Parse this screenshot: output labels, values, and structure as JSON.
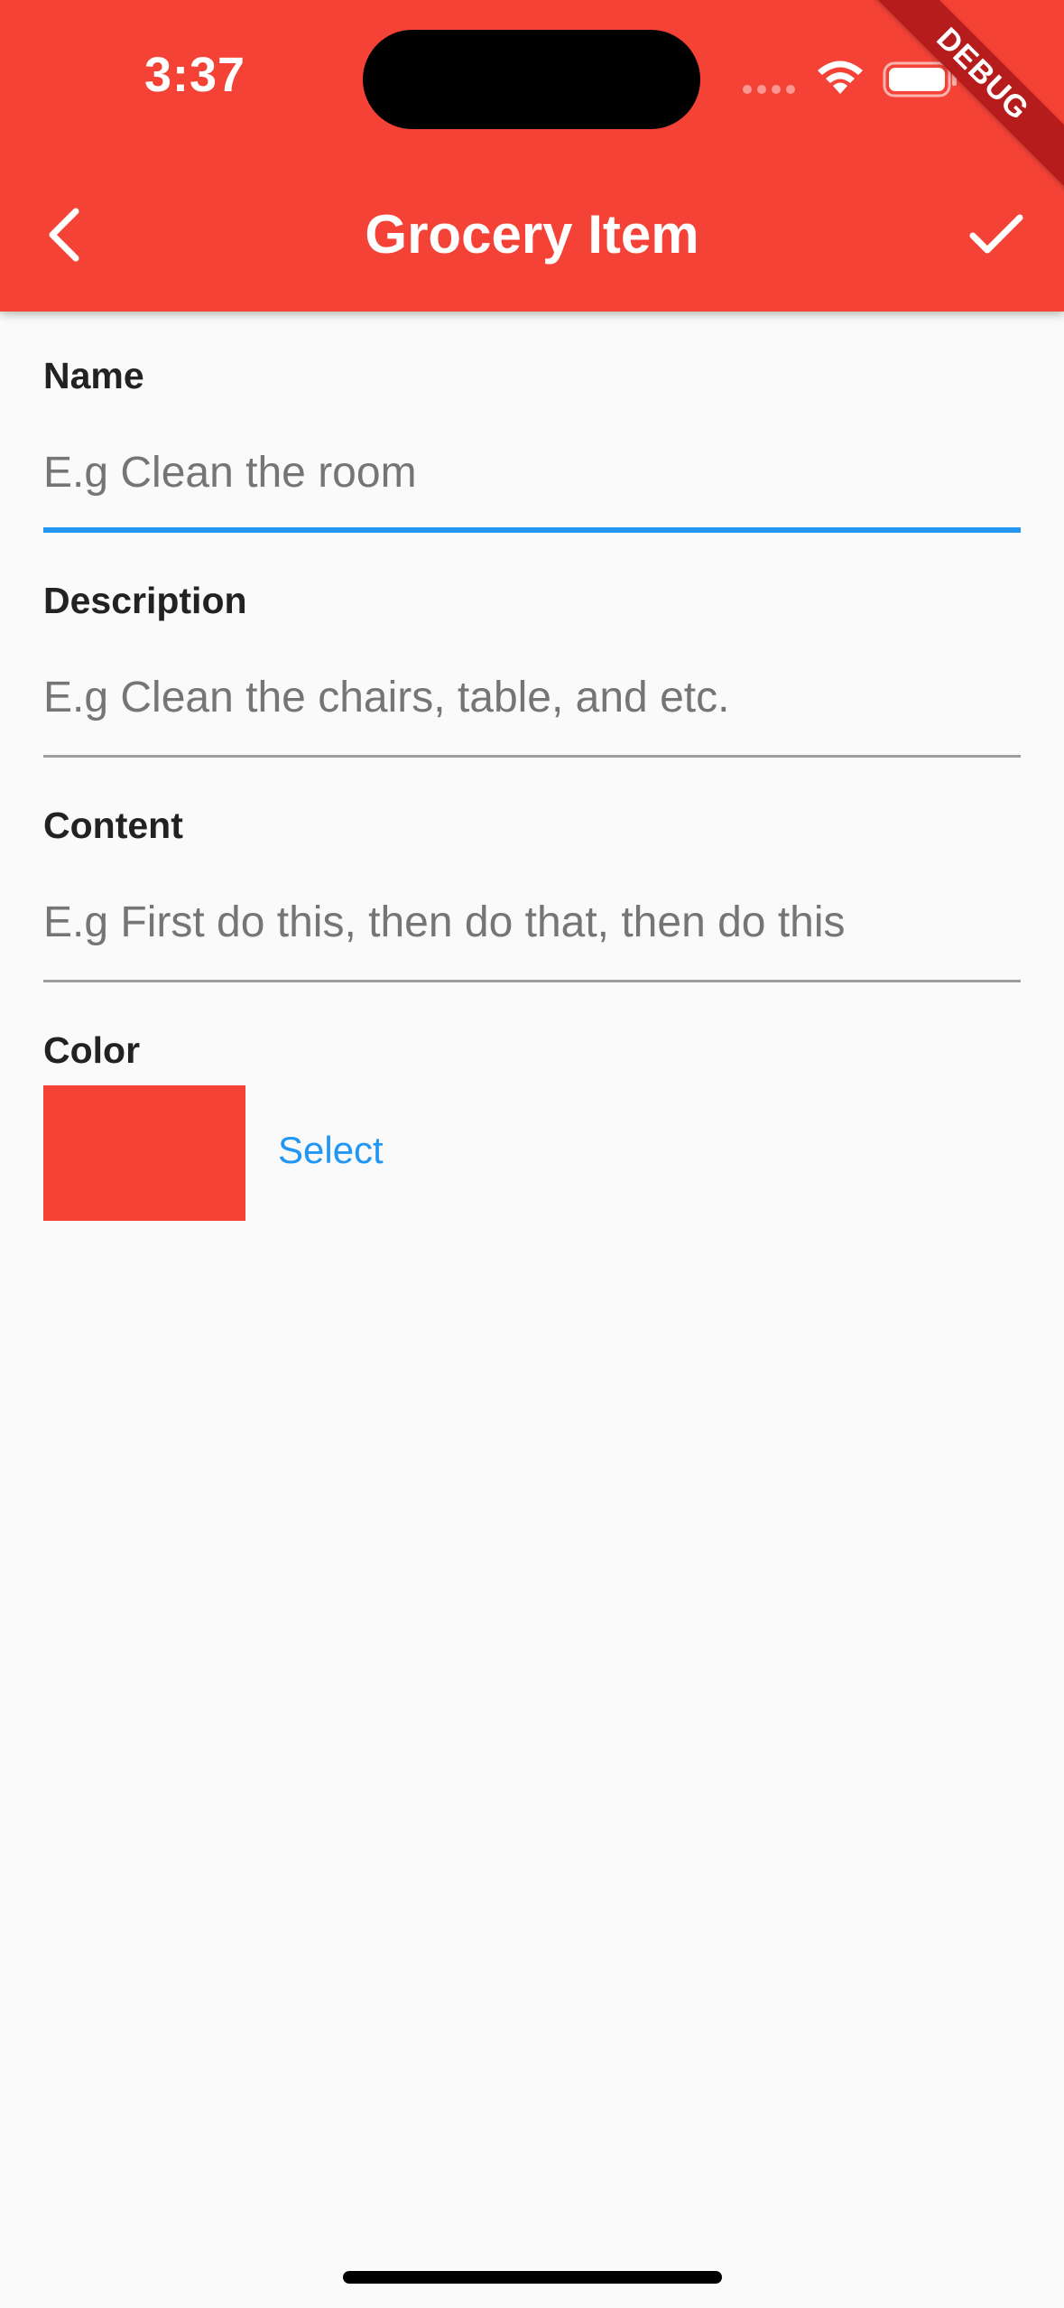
{
  "colors": {
    "primary": "#f44336",
    "accent": "#2196f3",
    "selected_color": "#f44336"
  },
  "status_bar": {
    "time": "3:37",
    "debug_label": "DEBUG"
  },
  "app_bar": {
    "title": "Grocery Item",
    "back_icon": "chevron-left-icon",
    "save_icon": "check-icon"
  },
  "form": {
    "name": {
      "label": "Name",
      "value": "",
      "placeholder": "E.g Clean the room"
    },
    "description": {
      "label": "Description",
      "value": "",
      "placeholder": "E.g Clean the chairs, table, and etc."
    },
    "content": {
      "label": "Content",
      "value": "",
      "placeholder": "E.g First do this, then do that, then do this"
    },
    "color": {
      "label": "Color",
      "select_label": "Select"
    }
  }
}
